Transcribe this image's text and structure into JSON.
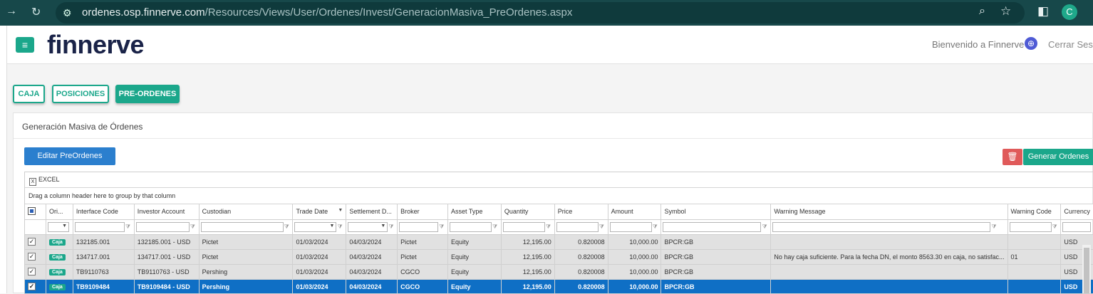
{
  "browser": {
    "url_host": "ordenes.osp.finnerve.com",
    "url_path": "/Resources/Views/User/Ordenes/Invest/GeneracionMasiva_PreOrdenes.aspx",
    "avatar_letter": "C"
  },
  "header": {
    "logo": "finnerve",
    "welcome": "Bienvenido a Finnerve",
    "logout": "Cerrar Sesión"
  },
  "tabs": [
    "CAJA",
    "POSICIONES",
    "PRE-ORDENES"
  ],
  "panel": {
    "title": "Generación Masiva de Órdenes",
    "edit_button": "Editar PreOrdenes",
    "generate_button": "Generar Ordenes"
  },
  "grid": {
    "excel_label": "EXCEL",
    "group_hint": "Drag a column header here to group by that column",
    "columns": [
      "Ori...",
      "Interface Code",
      "Investor Account",
      "Custodian",
      "Trade Date",
      "Settlement D...",
      "Broker",
      "Asset Type",
      "Quantity",
      "Price",
      "Amount",
      "Symbol",
      "Warning Message",
      "Warning Code",
      "Currency"
    ],
    "rows": [
      {
        "origin": "Caja",
        "interface_code": "132185.001",
        "investor_account": "132185.001 - USD",
        "custodian": "Pictet",
        "trade_date": "01/03/2024",
        "settlement_date": "04/03/2024",
        "broker": "Pictet",
        "asset_type": "Equity",
        "quantity": "12,195.00",
        "price": "0.820008",
        "amount": "10,000.00",
        "symbol": "BPCR:GB",
        "warning_message": "",
        "warning_code": "",
        "currency": "USD",
        "selected": false
      },
      {
        "origin": "Caja",
        "interface_code": "134717.001",
        "investor_account": "134717.001 - USD",
        "custodian": "Pictet",
        "trade_date": "01/03/2024",
        "settlement_date": "04/03/2024",
        "broker": "Pictet",
        "asset_type": "Equity",
        "quantity": "12,195.00",
        "price": "0.820008",
        "amount": "10,000.00",
        "symbol": "BPCR:GB",
        "warning_message": "No hay caja suficiente. Para la fecha DN, el monto 8563.30 en caja, no satisfac...",
        "warning_code": "01",
        "currency": "USD",
        "selected": false
      },
      {
        "origin": "Caja",
        "interface_code": "TB9110763",
        "investor_account": "TB9110763 - USD",
        "custodian": "Pershing",
        "trade_date": "01/03/2024",
        "settlement_date": "04/03/2024",
        "broker": "CGCO",
        "asset_type": "Equity",
        "quantity": "12,195.00",
        "price": "0.820008",
        "amount": "10,000.00",
        "symbol": "BPCR:GB",
        "warning_message": "",
        "warning_code": "",
        "currency": "USD",
        "selected": false
      },
      {
        "origin": "Caja",
        "interface_code": "TB9109484",
        "investor_account": "TB9109484 - USD",
        "custodian": "Pershing",
        "trade_date": "01/03/2024",
        "settlement_date": "04/03/2024",
        "broker": "CGCO",
        "asset_type": "Equity",
        "quantity": "12,195.00",
        "price": "0.820008",
        "amount": "10,000.00",
        "symbol": "BPCR:GB",
        "warning_message": "",
        "warning_code": "",
        "currency": "USD",
        "selected": true
      }
    ]
  },
  "colors": {
    "accent": "#1ba78b",
    "primary": "#2b7fce",
    "danger": "#e05a5a",
    "selected_row": "#0f6fc5",
    "warning": "#f28a1a",
    "browser_bar": "#17484a"
  }
}
